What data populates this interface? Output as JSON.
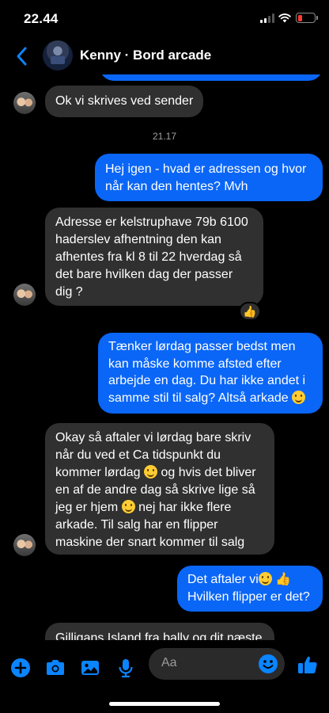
{
  "status_bar": {
    "time": "22.44"
  },
  "header": {
    "contact_name": "Kenny · Bord arcade"
  },
  "messages": [
    {
      "from": "them",
      "lines": [
        "Ok vi skrives ved sender"
      ]
    },
    {
      "timestamp": "21.17"
    },
    {
      "from": "me",
      "lines": [
        "Hej igen - hvad er adressen og hvor",
        "når kan den hentes? Mvh"
      ]
    },
    {
      "from": "them",
      "lines": [
        "Adresse er kelstruphave 79b 6100",
        "haderslev afhentning den kan",
        "afhentes fra kl 8 til 22 hverdag så",
        "det bare hvilken dag der passer",
        "dig ?"
      ],
      "reaction": "👍"
    },
    {
      "from": "me",
      "lines": [
        "Tænker lørdag passer bedst men",
        "kan måske komme afsted efter",
        "arbejde en dag. Du har ikke andet i",
        "samme stil til salg? Altså arkade"
      ]
    },
    {
      "from": "them",
      "lines": [
        "Okay så aftaler vi lørdag bare skriv",
        "når du ved et Ca tidspunkt du",
        "kommer lørdag",
        "og hvis det bliver",
        "en af de andre dag så skrive lige så",
        "jeg er hjem",
        "nej har ikke flere",
        "arkade. Til salg har en flipper",
        "maskine der snart kommer til salg"
      ]
    },
    {
      "from": "me",
      "lines": [
        "Det aftaler vi",
        "Hvilken flipper er det?"
      ],
      "emoji": "👍"
    },
    {
      "from": "them",
      "lines": [
        "Gilligans Island fra bally og dit næste"
      ]
    }
  ],
  "composer": {
    "placeholder": "Aa"
  },
  "colors": {
    "accent": "#0a66f7",
    "bubble_in": "#303030",
    "background": "#000000"
  },
  "icons": [
    "back-icon",
    "plus-icon",
    "camera-icon",
    "photo-icon",
    "microphone-icon",
    "emoji-icon",
    "thumbs-up-icon"
  ]
}
